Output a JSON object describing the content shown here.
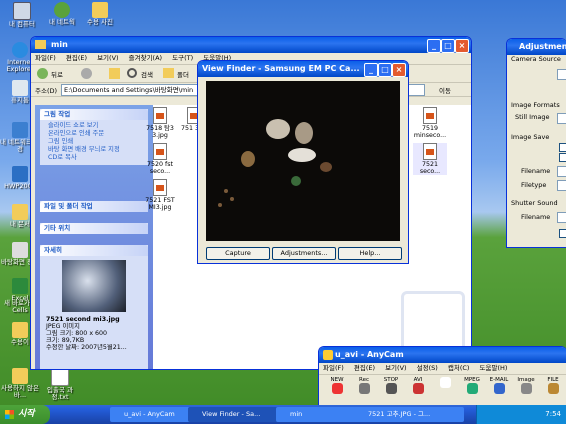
{
  "desktop": {
    "icons": [
      {
        "label": "내 컴퓨터"
      },
      {
        "label": "내 네트웍"
      },
      {
        "label": "수용 사진"
      },
      {
        "label": "Internet Explorer"
      },
      {
        "label": "휴지통"
      },
      {
        "label": "내 네트워크 환경"
      },
      {
        "label": "HWP2000"
      },
      {
        "label": "내 문서"
      },
      {
        "label": "바탕화면 정리"
      },
      {
        "label": "Excel"
      },
      {
        "label": "새 바로가기 Cells"
      },
      {
        "label": "수용이"
      },
      {
        "label": "사용하지 않은 바..."
      },
      {
        "label": "입출국 과정.txt"
      }
    ]
  },
  "explorer": {
    "title": "min",
    "menu": [
      "파일(F)",
      "편집(E)",
      "보기(V)",
      "즐겨찾기(A)",
      "도구(T)",
      "도움말(H)"
    ],
    "toolbar": {
      "back": "뒤로",
      "search": "검색",
      "folders": "폴더"
    },
    "address_label": "주소(D)",
    "address_value": "E:\\Documents and Settings\\바탕화면\\min",
    "go_label": "이동",
    "tasks": {
      "header": "그림 작업",
      "items": [
        "슬라이드 쇼로 보기",
        "온라인으로 인쇄 주문",
        "그림 인쇄",
        "바탕 화면 배경 무늬로 지정",
        "CD로 복사"
      ]
    },
    "file_tasks": {
      "header": "파일 및 폴더 작업"
    },
    "other_places": {
      "header": "기타 위치"
    },
    "details": {
      "header": "자세히",
      "name": "7521 second mi3.jpg",
      "type": "JPEG 이미지",
      "dimensions": "그림 크기: 800 x 600",
      "size": "크기: 89,7KB",
      "modified": "수정한 날짜: 2007년5월21..."
    },
    "files": [
      {
        "name": "7518 탐3 3.jpg"
      },
      {
        "name": "751 323"
      },
      {
        "name": "7519 minseco..."
      },
      {
        "name": "7520 fst seco..."
      },
      {
        "name": "7521 seco..."
      },
      {
        "name": "7521 FST MI3.jpg"
      }
    ]
  },
  "viewfinder": {
    "title": "View Finder - Samsung EM PC Ca...",
    "buttons": {
      "capture": "Capture",
      "adjustments": "Adjustments...",
      "help": "Help..."
    }
  },
  "adjustments": {
    "title": "Adjustments",
    "sections": {
      "camera_source": "Camera Source",
      "image_formats": "Image Formats",
      "still_image": "Still Image",
      "image_save": "Image Save",
      "filename": "Filename",
      "filetype": "Filetype",
      "shutter_sound": "Shutter Sound",
      "filename2": "Filename"
    }
  },
  "anycam": {
    "title": "u_avi - AnyCam",
    "menu": [
      "파일(F)",
      "편집(E)",
      "보기(V)",
      "설정(S)",
      "캡처(C)",
      "도움말(H)"
    ],
    "tools": [
      "NEW",
      "Rec",
      "STOP",
      "AVI",
      "",
      "MPEG",
      "E-MAIL",
      "Image",
      "FILE"
    ]
  },
  "taskbar": {
    "start": "시작",
    "buttons": [
      "u_avi - AnyCam",
      "View Finder - Sa...",
      "min",
      "7521 고추.JPG - 그..."
    ],
    "clock": "7:54"
  }
}
